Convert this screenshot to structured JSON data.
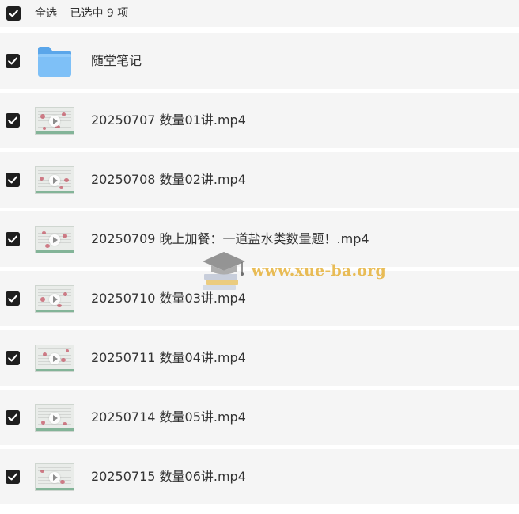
{
  "header": {
    "select_all_label": "全选",
    "selected_text": "已选中 9 项"
  },
  "items": [
    {
      "type": "folder",
      "name": "随堂笔记",
      "checked": true
    },
    {
      "type": "video",
      "name": "20250707 数量01讲.mp4",
      "checked": true
    },
    {
      "type": "video",
      "name": "20250708 数量02讲.mp4",
      "checked": true
    },
    {
      "type": "video",
      "name": "20250709 晚上加餐：一道盐水类数量题！.mp4",
      "checked": true
    },
    {
      "type": "video",
      "name": "20250710 数量03讲.mp4",
      "checked": true
    },
    {
      "type": "video",
      "name": "20250711 数量04讲.mp4",
      "checked": true
    },
    {
      "type": "video",
      "name": "20250714 数量05讲.mp4",
      "checked": true
    },
    {
      "type": "video",
      "name": "20250715 数量06讲.mp4",
      "checked": true
    }
  ],
  "watermark": {
    "text": "www.xue-ba.org",
    "icon": "graduation-cap-icon"
  },
  "colors": {
    "row_bg": "#f5f5f5",
    "checkbox_bg": "#1f1f1f",
    "watermark": "#e6b23a"
  }
}
